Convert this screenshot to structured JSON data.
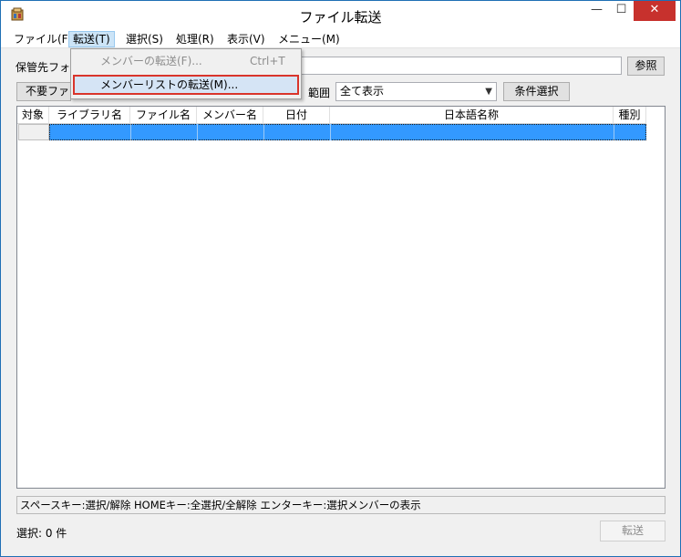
{
  "window": {
    "title": "ファイル転送",
    "minimize": "—",
    "maximize": "☐",
    "close": "✕"
  },
  "menubar": {
    "items": [
      "ファイル(F)",
      "転送(T)",
      "選択(S)",
      "処理(R)",
      "表示(V)",
      "メニュー(M)"
    ],
    "active_index": 1
  },
  "dropdown": {
    "items": [
      {
        "label": "メンバーの転送(F)...",
        "shortcut": "Ctrl+T",
        "enabled": false
      },
      {
        "label": "メンバーリストの転送(M)...",
        "shortcut": "",
        "enabled": true,
        "highlighted": true
      }
    ]
  },
  "form": {
    "dest_label": "保管先フォル",
    "dest_value": "",
    "browse_button": "参照",
    "unneeded_button": "不要ファイ",
    "range_label": "範囲",
    "range_value": "全て表示",
    "condition_button": "条件選択"
  },
  "table": {
    "columns": [
      "対象",
      "ライブラリ名",
      "ファイル名",
      "メンバー名",
      "日付",
      "日本語名称",
      "種別"
    ],
    "rows": [
      {
        "target": "",
        "library": "",
        "file": "",
        "member": "",
        "date": "",
        "jp_name": "",
        "type": "",
        "selected": true
      }
    ]
  },
  "help_text": "スペースキー:選択/解除 HOMEキー:全選択/全解除 エンターキー:選択メンバーの表示",
  "selection_count": "選択: 0 件",
  "transfer_button": "転送",
  "colors": {
    "selection": "#3399ff",
    "highlight_border": "#d9342b",
    "close_button": "#c7312d"
  }
}
